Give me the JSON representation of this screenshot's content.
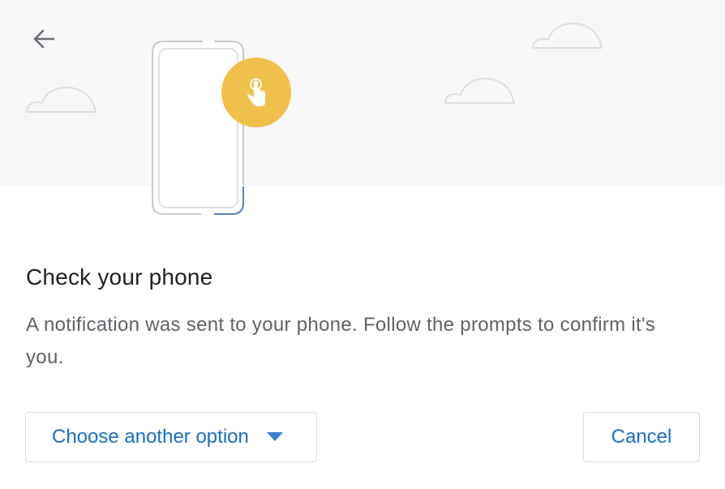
{
  "header": {
    "back_icon": "arrow-left-icon"
  },
  "illustration": {
    "phone_icon": "phone-outline-icon",
    "badge_icon": "tap-hand-icon",
    "badge_color": "#f0c04c",
    "cloud_icon": "cloud-outline-icon"
  },
  "content": {
    "title": "Check your phone",
    "message": "A notification was sent to your phone. Follow the prompts to confirm it's you."
  },
  "actions": {
    "other_option_label": "Choose another option",
    "other_option_icon": "caret-down-icon",
    "cancel_label": "Cancel",
    "link_color": "#1a6fc4"
  }
}
